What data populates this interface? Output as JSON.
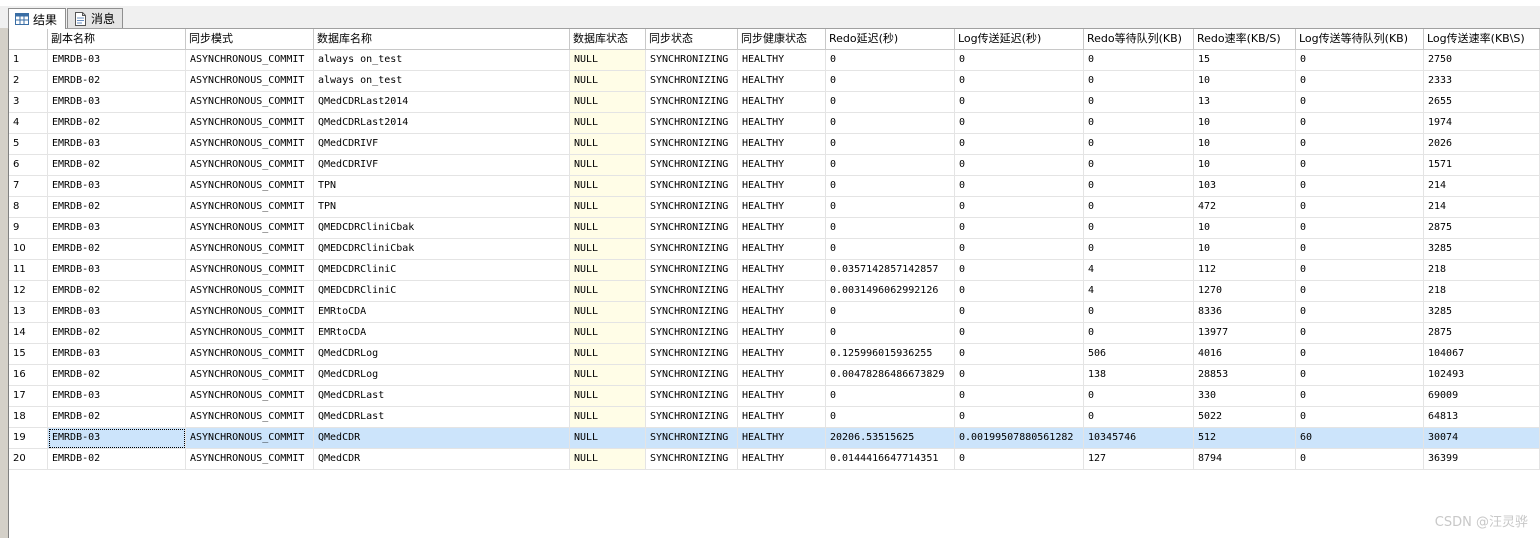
{
  "tabs": [
    {
      "label": "结果",
      "icon": "grid-icon",
      "active": true
    },
    {
      "label": "消息",
      "icon": "message-icon",
      "active": false
    }
  ],
  "grid": {
    "columns": [
      "",
      "副本名称",
      "同步模式",
      "数据库名称",
      "数据库状态",
      "同步状态",
      "同步健康状态",
      "Redo延迟(秒)",
      "Log传送延迟(秒)",
      "Redo等待队列(KB)",
      "Redo速率(KB/S)",
      "Log传送等待队列(KB)",
      "Log传送速率(KB\\S)"
    ],
    "rows": [
      [
        "1",
        "EMRDB-03",
        "ASYNCHRONOUS_COMMIT",
        "always on_test",
        "NULL",
        "SYNCHRONIZING",
        "HEALTHY",
        "0",
        "0",
        "0",
        "15",
        "0",
        "2750"
      ],
      [
        "2",
        "EMRDB-02",
        "ASYNCHRONOUS_COMMIT",
        "always on_test",
        "NULL",
        "SYNCHRONIZING",
        "HEALTHY",
        "0",
        "0",
        "0",
        "10",
        "0",
        "2333"
      ],
      [
        "3",
        "EMRDB-03",
        "ASYNCHRONOUS_COMMIT",
        "QMedCDRLast2014",
        "NULL",
        "SYNCHRONIZING",
        "HEALTHY",
        "0",
        "0",
        "0",
        "13",
        "0",
        "2655"
      ],
      [
        "4",
        "EMRDB-02",
        "ASYNCHRONOUS_COMMIT",
        "QMedCDRLast2014",
        "NULL",
        "SYNCHRONIZING",
        "HEALTHY",
        "0",
        "0",
        "0",
        "10",
        "0",
        "1974"
      ],
      [
        "5",
        "EMRDB-03",
        "ASYNCHRONOUS_COMMIT",
        "QMedCDRIVF",
        "NULL",
        "SYNCHRONIZING",
        "HEALTHY",
        "0",
        "0",
        "0",
        "10",
        "0",
        "2026"
      ],
      [
        "6",
        "EMRDB-02",
        "ASYNCHRONOUS_COMMIT",
        "QMedCDRIVF",
        "NULL",
        "SYNCHRONIZING",
        "HEALTHY",
        "0",
        "0",
        "0",
        "10",
        "0",
        "1571"
      ],
      [
        "7",
        "EMRDB-03",
        "ASYNCHRONOUS_COMMIT",
        "TPN",
        "NULL",
        "SYNCHRONIZING",
        "HEALTHY",
        "0",
        "0",
        "0",
        "103",
        "0",
        "214"
      ],
      [
        "8",
        "EMRDB-02",
        "ASYNCHRONOUS_COMMIT",
        "TPN",
        "NULL",
        "SYNCHRONIZING",
        "HEALTHY",
        "0",
        "0",
        "0",
        "472",
        "0",
        "214"
      ],
      [
        "9",
        "EMRDB-03",
        "ASYNCHRONOUS_COMMIT",
        "QMEDCDRCliniCbak",
        "NULL",
        "SYNCHRONIZING",
        "HEALTHY",
        "0",
        "0",
        "0",
        "10",
        "0",
        "2875"
      ],
      [
        "10",
        "EMRDB-02",
        "ASYNCHRONOUS_COMMIT",
        "QMEDCDRCliniCbak",
        "NULL",
        "SYNCHRONIZING",
        "HEALTHY",
        "0",
        "0",
        "0",
        "10",
        "0",
        "3285"
      ],
      [
        "11",
        "EMRDB-03",
        "ASYNCHRONOUS_COMMIT",
        "QMEDCDRCliniC",
        "NULL",
        "SYNCHRONIZING",
        "HEALTHY",
        "0.0357142857142857",
        "0",
        "4",
        "112",
        "0",
        "218"
      ],
      [
        "12",
        "EMRDB-02",
        "ASYNCHRONOUS_COMMIT",
        "QMEDCDRCliniC",
        "NULL",
        "SYNCHRONIZING",
        "HEALTHY",
        "0.0031496062992126",
        "0",
        "4",
        "1270",
        "0",
        "218"
      ],
      [
        "13",
        "EMRDB-03",
        "ASYNCHRONOUS_COMMIT",
        "EMRtoCDA",
        "NULL",
        "SYNCHRONIZING",
        "HEALTHY",
        "0",
        "0",
        "0",
        "8336",
        "0",
        "3285"
      ],
      [
        "14",
        "EMRDB-02",
        "ASYNCHRONOUS_COMMIT",
        "EMRtoCDA",
        "NULL",
        "SYNCHRONIZING",
        "HEALTHY",
        "0",
        "0",
        "0",
        "13977",
        "0",
        "2875"
      ],
      [
        "15",
        "EMRDB-03",
        "ASYNCHRONOUS_COMMIT",
        "QMedCDRLog",
        "NULL",
        "SYNCHRONIZING",
        "HEALTHY",
        "0.125996015936255",
        "0",
        "506",
        "4016",
        "0",
        "104067"
      ],
      [
        "16",
        "EMRDB-02",
        "ASYNCHRONOUS_COMMIT",
        "QMedCDRLog",
        "NULL",
        "SYNCHRONIZING",
        "HEALTHY",
        "0.00478286486673829",
        "0",
        "138",
        "28853",
        "0",
        "102493"
      ],
      [
        "17",
        "EMRDB-03",
        "ASYNCHRONOUS_COMMIT",
        "QMedCDRLast",
        "NULL",
        "SYNCHRONIZING",
        "HEALTHY",
        "0",
        "0",
        "0",
        "330",
        "0",
        "69009"
      ],
      [
        "18",
        "EMRDB-02",
        "ASYNCHRONOUS_COMMIT",
        "QMedCDRLast",
        "NULL",
        "SYNCHRONIZING",
        "HEALTHY",
        "0",
        "0",
        "0",
        "5022",
        "0",
        "64813"
      ],
      [
        "19",
        "EMRDB-03",
        "ASYNCHRONOUS_COMMIT",
        "QMedCDR",
        "NULL",
        "SYNCHRONIZING",
        "HEALTHY",
        "20206.53515625",
        "0.00199507880561282",
        "10345746",
        "512",
        "60",
        "30074"
      ],
      [
        "20",
        "EMRDB-02",
        "ASYNCHRONOUS_COMMIT",
        "QMedCDR",
        "NULL",
        "SYNCHRONIZING",
        "HEALTHY",
        "0.0144416647714351",
        "0",
        "127",
        "8794",
        "0",
        "36399"
      ]
    ],
    "selected_row": 19,
    "highlight_color": "#cce4fb",
    "state_column_color": "#fffde7"
  },
  "watermark": "CSDN @汪灵骅"
}
